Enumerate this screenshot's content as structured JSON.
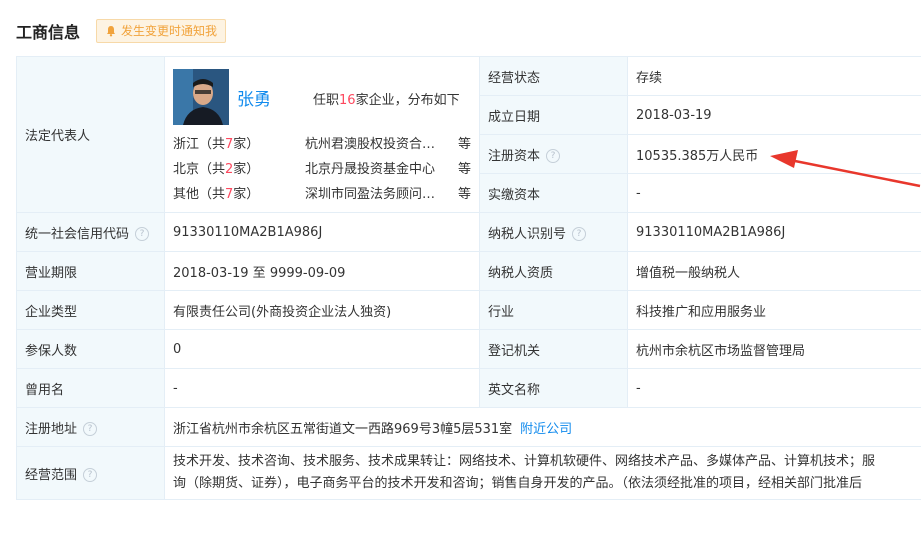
{
  "header": {
    "title": "工商信息",
    "notify_label": "发生变更时通知我"
  },
  "legal_rep": {
    "label": "法定代表人",
    "name": "张勇",
    "stats_prefix": "任职",
    "stats_count": "16",
    "stats_suffix": "家企业，分布如下",
    "distribution": [
      {
        "region_prefix": "浙江（共",
        "count": "7",
        "region_suffix": "家）",
        "company": "杭州君澳股权投资合伙企业",
        "etc": "等"
      },
      {
        "region_prefix": "北京（共",
        "count": "2",
        "region_suffix": "家）",
        "company": "北京丹晟投资基金中心",
        "etc": "等"
      },
      {
        "region_prefix": "其他（共",
        "count": "7",
        "region_suffix": "家）",
        "company": "深圳市同盈法务顾问有限公司",
        "etc": "等"
      }
    ]
  },
  "right_top": [
    {
      "label": "经营状态",
      "value": "存续"
    },
    {
      "label": "成立日期",
      "value": "2018-03-19"
    },
    {
      "label": "注册资本",
      "value": "10535.385万人民币"
    },
    {
      "label": "实缴资本",
      "value": "-"
    }
  ],
  "rows": [
    {
      "l1": "统一社会信用代码",
      "v1": "91330110MA2B1A986J",
      "l2": "纳税人识别号",
      "v2": "91330110MA2B1A986J"
    },
    {
      "l1": "营业期限",
      "v1": "2018-03-19 至 9999-09-09",
      "l2": "纳税人资质",
      "v2": "增值税一般纳税人"
    },
    {
      "l1": "企业类型",
      "v1": "有限责任公司(外商投资企业法人独资)",
      "l2": "行业",
      "v2": "科技推广和应用服务业"
    },
    {
      "l1": "参保人数",
      "v1": "0",
      "l2": "登记机关",
      "v2": "杭州市余杭区市场监督管理局"
    },
    {
      "l1": "曾用名",
      "v1": "-",
      "l2": "英文名称",
      "v2": "-"
    }
  ],
  "address": {
    "label": "注册地址",
    "value": "浙江省杭州市余杭区五常街道文一西路969号3幢5层531室",
    "link": "附近公司"
  },
  "scope": {
    "label": "经营范围",
    "line1": "技术开发、技术咨询、技术服务、技术成果转让：网络技术、计算机软硬件、网络技术产品、多媒体产品、计算机技术；服",
    "line2": "询（除期货、证券），电子商务平台的技术开发和咨询；销售自身开发的产品。（依法须经批准的项目，经相关部门批准后"
  },
  "help_glyph": "?",
  "colors": {
    "link": "#128bed",
    "label_bg": "#f2f9fc",
    "accent_red": "#fd485e",
    "notify": "#f1a33c",
    "arrow": "#e8372c"
  }
}
